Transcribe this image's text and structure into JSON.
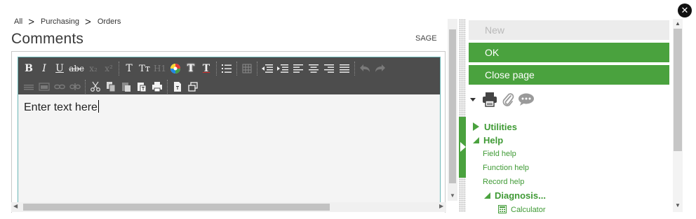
{
  "breadcrumb": {
    "items": [
      "All",
      "Purchasing",
      "Orders"
    ],
    "separator": ">"
  },
  "page": {
    "title": "Comments",
    "tag": "SAGE"
  },
  "editor": {
    "toolbar_row1": [
      "B",
      "I",
      "U",
      "abc",
      "x₂",
      "x²",
      "T",
      "Tᴛ",
      "H1",
      "color",
      "T",
      "T",
      "list",
      "table",
      "outdent",
      "indent",
      "align-left",
      "align-center",
      "align-right",
      "justify",
      "undo",
      "redo"
    ],
    "toolbar_row2": [
      "hr",
      "image",
      "link",
      "unlink",
      "cut",
      "copy",
      "paste",
      "paste-text",
      "print",
      "source",
      "fullscreen"
    ],
    "content": "Enter text here"
  },
  "actions": {
    "new_label": "New",
    "ok_label": "OK",
    "close_label": "Close page"
  },
  "icons": {
    "print": "print-icon",
    "attach": "paperclip-icon",
    "comment": "comment-icon",
    "close": "close-icon"
  },
  "tree": {
    "utilities": "Utilities",
    "help": "Help",
    "field_help": "Field help",
    "function_help": "Function help",
    "record_help": "Record help",
    "diagnosis": "Diagnosis...",
    "calculator": "Calculator"
  },
  "colors": {
    "accent": "#4aa23e",
    "toolbar": "#4d4d4d",
    "disabled": "#ececec"
  }
}
